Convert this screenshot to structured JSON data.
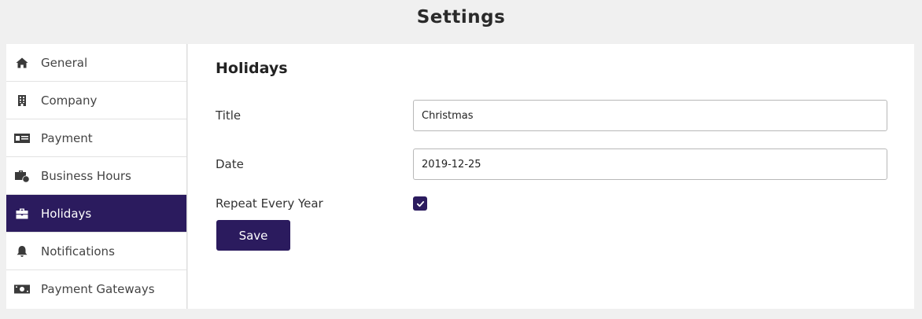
{
  "header": {
    "title": "Settings"
  },
  "sidebar": {
    "items": [
      {
        "label": "General",
        "icon": "home-icon"
      },
      {
        "label": "Company",
        "icon": "building-icon"
      },
      {
        "label": "Payment",
        "icon": "money-check-icon"
      },
      {
        "label": "Business Hours",
        "icon": "business-time-icon"
      },
      {
        "label": "Holidays",
        "icon": "briefcase-icon",
        "active": true
      },
      {
        "label": "Notifications",
        "icon": "bell-icon"
      },
      {
        "label": "Payment Gateways",
        "icon": "money-bill-icon"
      }
    ]
  },
  "main": {
    "section_title": "Holidays",
    "form": {
      "title_label": "Title",
      "title_value": "Christmas",
      "date_label": "Date",
      "date_value": "2019-12-25",
      "repeat_label": "Repeat Every Year",
      "repeat_checked": true,
      "save_label": "Save"
    }
  },
  "colors": {
    "accent": "#2b1b5e",
    "background": "#f0f0f0",
    "panel": "#ffffff"
  }
}
